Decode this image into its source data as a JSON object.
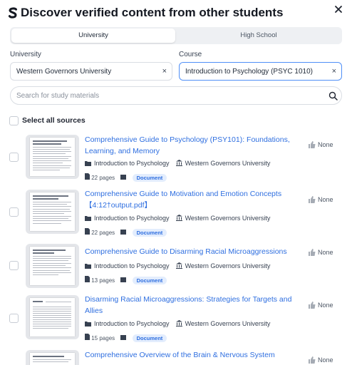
{
  "header": {
    "title": "Discover verified content from other students",
    "logo_icon": "studocu-logo-icon",
    "close_icon": "close-icon"
  },
  "tabs": [
    {
      "label": "University",
      "active": true
    },
    {
      "label": "High School",
      "active": false
    }
  ],
  "filters": {
    "university": {
      "label": "University",
      "value": "Western Governors University",
      "clear": "×"
    },
    "course": {
      "label": "Course",
      "value": "Introduction to Psychology (PSYC 1010)",
      "clear": "×"
    }
  },
  "search": {
    "placeholder": "Search for study materials",
    "value": ""
  },
  "select_all": {
    "label": "Select all sources",
    "checked": false
  },
  "documents": [
    {
      "title": "Comprehensive Guide to Psychology (PSY101): Foundations, Learning, and Memory",
      "course": "Introduction to Psychology",
      "university": "Western Governors University",
      "pages": "22 pages",
      "type": "Document",
      "votes": "None"
    },
    {
      "title": "Comprehensive Guide to Motivation and Emotion Concepts 【4:12†output.pdf】",
      "course": "Introduction to Psychology",
      "university": "Western Governors University",
      "pages": "22 pages",
      "type": "Document",
      "votes": "None"
    },
    {
      "title": "Comprehensive Guide to Disarming Racial Microaggressions",
      "course": "Introduction to Psychology",
      "university": "Western Governors University",
      "pages": "13 pages",
      "type": "Document",
      "votes": "None"
    },
    {
      "title": "Disarming Racial Microaggressions: Strategies for Targets and Allies",
      "course": "Introduction to Psychology",
      "university": "Western Governors University",
      "pages": "15 pages",
      "type": "Document",
      "votes": "None"
    },
    {
      "title": "Comprehensive Overview of the Brain & Nervous System",
      "votes": "None"
    }
  ],
  "colors": {
    "link": "#2f6fe0",
    "badge_bg": "#e3edfd",
    "focus_border": "#4f8ff7",
    "tab_track": "#eef0f3"
  }
}
